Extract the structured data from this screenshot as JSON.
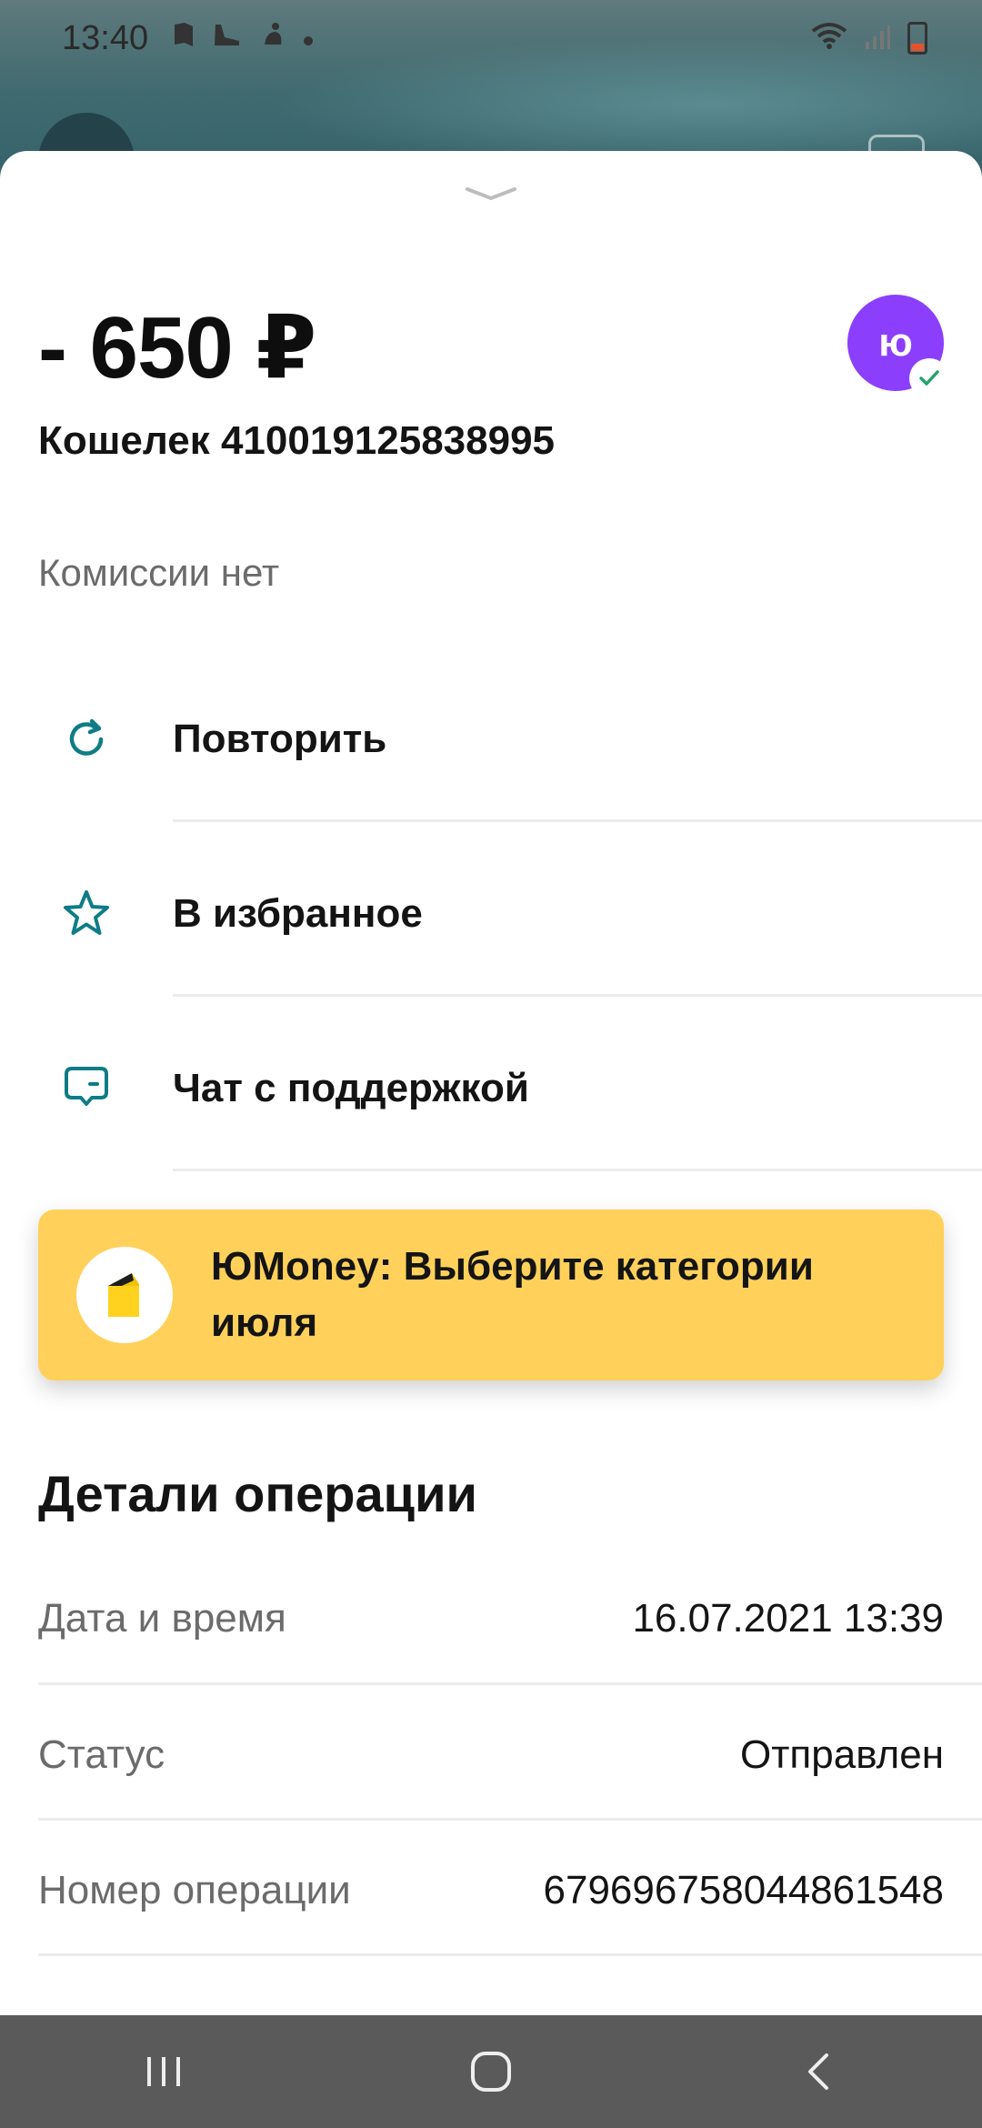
{
  "status_bar": {
    "time": "13:40",
    "notification_icons": [
      "book-icon",
      "shoe-icon",
      "figure-icon",
      "dot-icon"
    ]
  },
  "transaction": {
    "amount": "- 650 ₽",
    "recipient": "Кошелек 410019125838995",
    "brand_logo_text": "ю",
    "commission": "Комиссии нет"
  },
  "actions": [
    {
      "label": "Повторить",
      "icon": "repeat-icon"
    },
    {
      "label": "В избранное",
      "icon": "star-icon"
    },
    {
      "label": "Чат с поддержкой",
      "icon": "chat-icon"
    }
  ],
  "promo": {
    "text": "ЮMoney: Выберите категории июля"
  },
  "details": {
    "title": "Детали операции",
    "rows": [
      {
        "key": "Дата и время",
        "value": "16.07.2021 13:39"
      },
      {
        "key": "Статус",
        "value": "Отправлен"
      },
      {
        "key": "Номер операции",
        "value": "679696758044861548"
      }
    ]
  },
  "colors": {
    "accent_teal": "#0e7c86",
    "brand_purple": "#8b3ffd",
    "promo_yellow": "#ffd15a",
    "check_green": "#20a56a"
  }
}
